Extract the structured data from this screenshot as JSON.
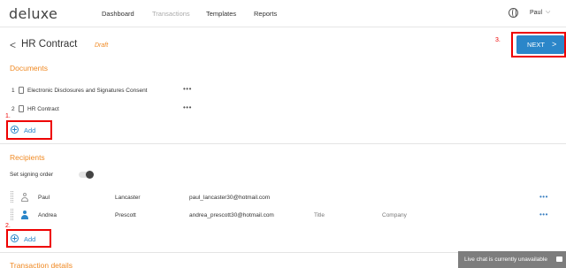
{
  "header": {
    "logo": "deluxe",
    "nav": [
      "Dashboard",
      "Transactions",
      "Templates",
      "Reports"
    ],
    "user": "Paul",
    "globe_icon": "globe-icon",
    "caret": "⌵"
  },
  "page": {
    "back": "<",
    "title": "HR Contract",
    "status": "Draft",
    "next_label": "NEXT",
    "next_chevron": ">"
  },
  "annotations": {
    "step1": "1.",
    "step2": "2.",
    "step3": "3.",
    "highlight_color": "#e00000"
  },
  "documents": {
    "heading": "Documents",
    "items": [
      {
        "num": "1",
        "name": "Electronic Disclosures and Signatures Consent",
        "menu": "•••"
      },
      {
        "num": "2",
        "name": "HR Contract",
        "menu": "•••"
      }
    ],
    "add_label": "Add"
  },
  "recipients": {
    "heading": "Recipients",
    "signing_order_label": "Set signing order",
    "rows": [
      {
        "first": "Paul",
        "last": "Lancaster",
        "email": "paul_lancaster30@hotmail.com",
        "title": "",
        "company": "",
        "menu": "•••"
      },
      {
        "first": "Andrea",
        "last": "Prescott",
        "email": "andrea_prescott30@hotmail.com",
        "title": "Title",
        "company": "Company",
        "menu": "•••"
      }
    ],
    "add_label": "Add"
  },
  "transaction_details": {
    "heading": "Transaction details"
  },
  "chat": {
    "text": "Live chat is currently unavailable"
  },
  "colors": {
    "accent_orange": "#f08a24",
    "primary_blue": "#2b86c9",
    "chat_bg": "#7d7d7d"
  }
}
